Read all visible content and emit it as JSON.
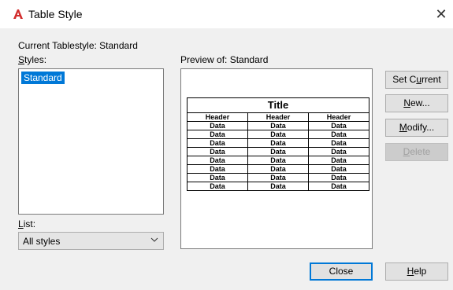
{
  "window": {
    "title": "Table Style",
    "close_glyph": "✕",
    "app_icon": "autocad-a-icon",
    "accent_red": "#d22d2d"
  },
  "current_tablestyle": {
    "label": "Current Tablestyle:",
    "value": "Standard"
  },
  "styles": {
    "label_accel": "S",
    "label_rest": "tyles:",
    "items": [
      "Standard"
    ],
    "selected_index": 0
  },
  "list_filter": {
    "label_accel": "L",
    "label_rest": "ist:",
    "selected": "All styles"
  },
  "preview": {
    "label_prefix": "Preview of:",
    "style_name": "Standard",
    "table": {
      "title": "Title",
      "headers": [
        "Header",
        "Header",
        "Header"
      ],
      "rows": [
        [
          "Data",
          "Data",
          "Data"
        ],
        [
          "Data",
          "Data",
          "Data"
        ],
        [
          "Data",
          "Data",
          "Data"
        ],
        [
          "Data",
          "Data",
          "Data"
        ],
        [
          "Data",
          "Data",
          "Data"
        ],
        [
          "Data",
          "Data",
          "Data"
        ],
        [
          "Data",
          "Data",
          "Data"
        ],
        [
          "Data",
          "Data",
          "Data"
        ]
      ]
    }
  },
  "buttons": {
    "set_current": {
      "pre": "Set C",
      "accel": "u",
      "post": "rrent",
      "enabled": true
    },
    "new": {
      "pre": "",
      "accel": "N",
      "post": "ew...",
      "enabled": true
    },
    "modify": {
      "pre": "",
      "accel": "M",
      "post": "odify...",
      "enabled": true
    },
    "delete": {
      "pre": "",
      "accel": "D",
      "post": "elete",
      "enabled": false
    },
    "close": {
      "label": "Close"
    },
    "help": {
      "pre": "",
      "accel": "H",
      "post": "elp"
    }
  }
}
